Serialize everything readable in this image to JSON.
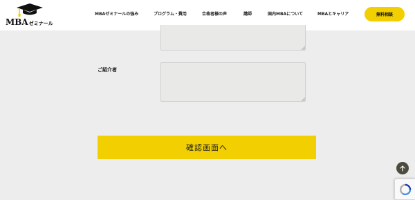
{
  "header": {
    "logo": {
      "text": "MBA",
      "subtext": "ゼミナール"
    },
    "nav": [
      {
        "label": "MBAゼミナールの強み"
      },
      {
        "label": "プログラム・費用"
      },
      {
        "label": "合格者様の声"
      },
      {
        "label": "講師"
      },
      {
        "label": "国内MBAについて"
      },
      {
        "label": "MBAとキャリア"
      }
    ],
    "cta_label": "無料相談"
  },
  "form": {
    "referrer_label": "ご紹介者",
    "submit_label": "確認画面へ"
  },
  "colors": {
    "accent": "#f2cf00",
    "background": "#ededed",
    "field": "#e9e9e8",
    "back_to_top": "#4d4b3d"
  },
  "icons": {
    "logo": "graduation-cap-icon",
    "back_to_top": "arrow-up-icon",
    "recaptcha": "recaptcha-icon"
  }
}
